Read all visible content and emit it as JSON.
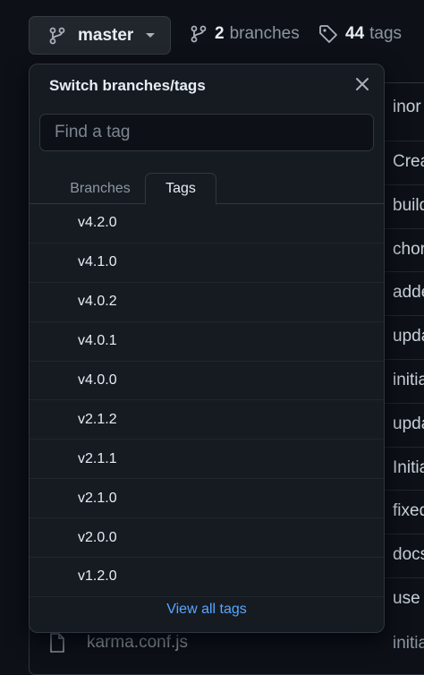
{
  "topbar": {
    "branch_selector_label": "master",
    "branches_count": "2",
    "branches_label": "branches",
    "tags_count": "44",
    "tags_label": "tags"
  },
  "background": {
    "header_partial": "inor",
    "row_messages": [
      "Crea",
      "build",
      "chor",
      "adde",
      "upda",
      "initia",
      "upda",
      "Initia",
      "fixed",
      "docs",
      "use"
    ],
    "visible_file": {
      "name": "karma.conf.js",
      "message": "initia"
    }
  },
  "dropdown": {
    "title": "Switch branches/tags",
    "search_placeholder": "Find a tag",
    "search_value": "",
    "tabs": [
      {
        "label": "Branches",
        "selected": false
      },
      {
        "label": "Tags",
        "selected": true
      }
    ],
    "tags": [
      "v4.2.0",
      "v4.1.0",
      "v4.0.2",
      "v4.0.1",
      "v4.0.0",
      "v2.1.2",
      "v2.1.1",
      "v2.1.0",
      "v2.0.0",
      "v1.2.0"
    ],
    "view_all_label": "View all tags"
  },
  "colors": {
    "background": "#0d1117",
    "panel": "#161b22",
    "border": "#30363d",
    "text": "#e6edf3",
    "muted": "#8d96a0",
    "link": "#58a6ff"
  }
}
